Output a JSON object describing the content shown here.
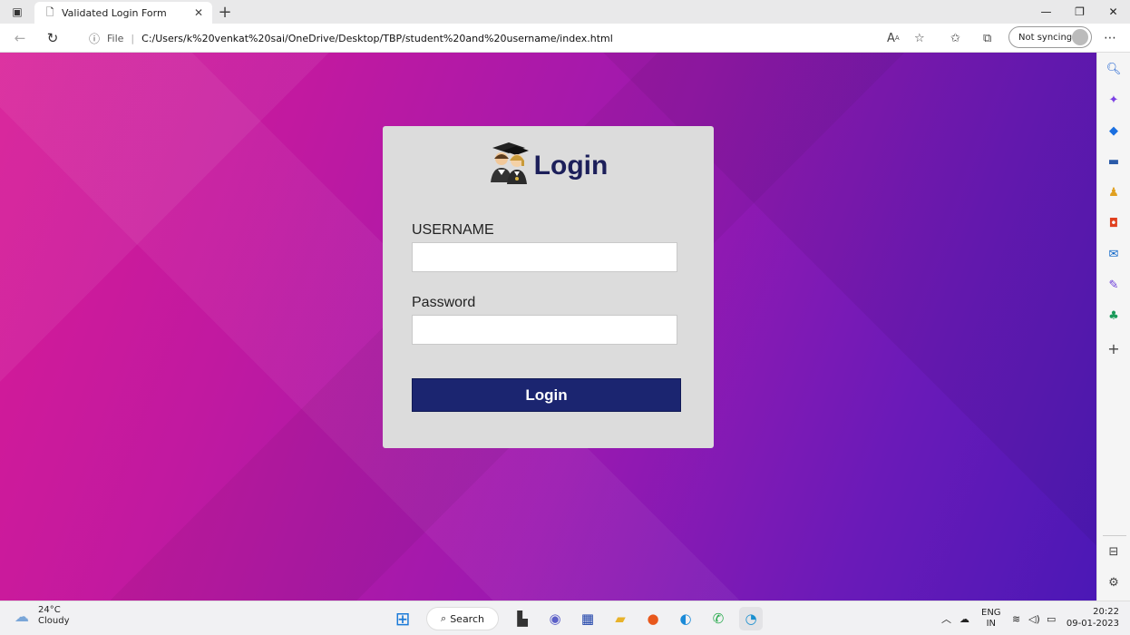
{
  "browser": {
    "tab_title": "Validated Login Form",
    "new_tab_symbol": "+",
    "address_prefix": "File",
    "url": "C:/Users/k%20venkat%20sai/OneDrive/Desktop/TBP/student%20and%20username/index.html",
    "sync_label": "Not syncing"
  },
  "login": {
    "title": "Login",
    "username_label": "USERNAME",
    "username_value": "",
    "password_label": "Password",
    "password_value": "",
    "submit_label": "Login"
  },
  "taskbar": {
    "weather_temp": "24°C",
    "weather_desc": "Cloudy",
    "search_label": "Search",
    "lang_primary": "ENG",
    "lang_region": "IN",
    "time": "20:22",
    "date": "09-01-2023"
  },
  "colors": {
    "card_title": "#1c1f5a",
    "login_button": "#1b2570",
    "background_start": "#d81b96",
    "background_end": "#4b18b6"
  }
}
